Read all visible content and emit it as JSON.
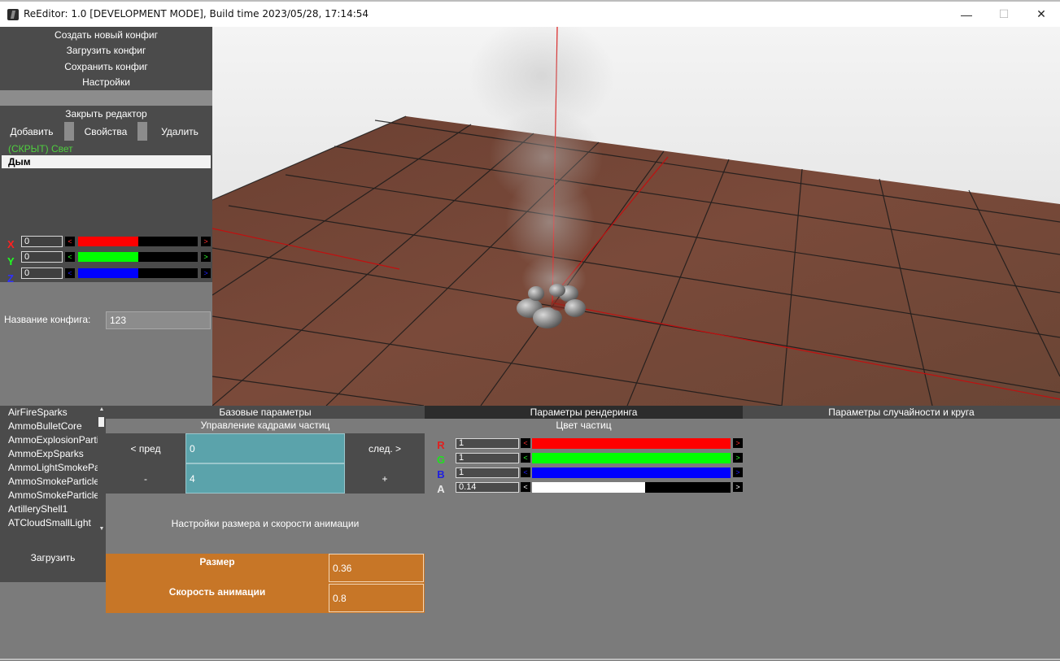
{
  "window": {
    "title": "ReEditor: 1.0 [DEVELOPMENT MODE], Build time 2023/05/28, 17:14:54",
    "minimize_glyph": "—",
    "maximize_glyph": "☐",
    "close_glyph": "✕"
  },
  "menu": {
    "items": [
      "Создать новый конфиг",
      "Загрузить конфиг",
      "Сохранить конфиг",
      "Настройки"
    ],
    "close_editor": "Закрыть редактор"
  },
  "actions": {
    "add": "Добавить",
    "properties": "Свойства",
    "delete": "Удалить"
  },
  "objects": {
    "hidden_item": "(СКРЫТ) Свет",
    "selected_item": "Дым"
  },
  "axes": [
    {
      "label": "X",
      "value": "0",
      "color": "#ff0000",
      "fill": 0.5,
      "left_arrow_color": "#ff3030",
      "right_arrow_color": "#ff3030"
    },
    {
      "label": "Y",
      "value": "0",
      "color": "#00ff00",
      "fill": 0.5,
      "left_arrow_color": "#30ff30",
      "right_arrow_color": "#30ff30"
    },
    {
      "label": "Z",
      "value": "0",
      "color": "#0000ff",
      "fill": 0.5,
      "left_arrow_color": "#2020ff",
      "right_arrow_color": "#2020ff"
    }
  ],
  "arrows": {
    "left": "<",
    "right": ">"
  },
  "config": {
    "label": "Название конфига:",
    "value": "123"
  },
  "effects": {
    "items": [
      "AirFireSparks",
      "AmmoBulletCore",
      "AmmoExplosionParti",
      "AmmoExpSparks",
      "AmmoLightSmokePa",
      "AmmoSmokeParticle",
      "AmmoSmokeParticle",
      "ArtilleryShell1",
      "ATCloudSmallLight"
    ],
    "load_button": "Загрузить",
    "scroll_up": "▲",
    "scroll_down": "▼"
  },
  "tabs": [
    "Базовые параметры",
    "Параметры рендеринга",
    "Параметры случайности и круга"
  ],
  "frames": {
    "title": "Управление кадрами частиц",
    "prev": "< пред",
    "next": "след. >",
    "minus": "-",
    "plus": "+",
    "frame_value": "0",
    "count_value": "4"
  },
  "animation": {
    "title": "Настройки размера и скорости анимации",
    "size_label": "Размер",
    "size_value": "0.36",
    "speed_label": "Скорость анимации",
    "speed_value": "0.8"
  },
  "particle_color": {
    "title": "Цвет частиц",
    "channels": [
      {
        "label": "R",
        "value": "1",
        "color": "#ff0000",
        "fill": 1.0,
        "label_color": "#e02020"
      },
      {
        "label": "G",
        "value": "1",
        "color": "#00ff00",
        "fill": 1.0,
        "label_color": "#20e020"
      },
      {
        "label": "B",
        "value": "1",
        "color": "#0000ff",
        "fill": 1.0,
        "label_color": "#2020e0"
      },
      {
        "label": "A",
        "value": "0.14",
        "color": "#ffffff",
        "fill": 0.57,
        "label_color": "#e8e8e8"
      }
    ]
  }
}
